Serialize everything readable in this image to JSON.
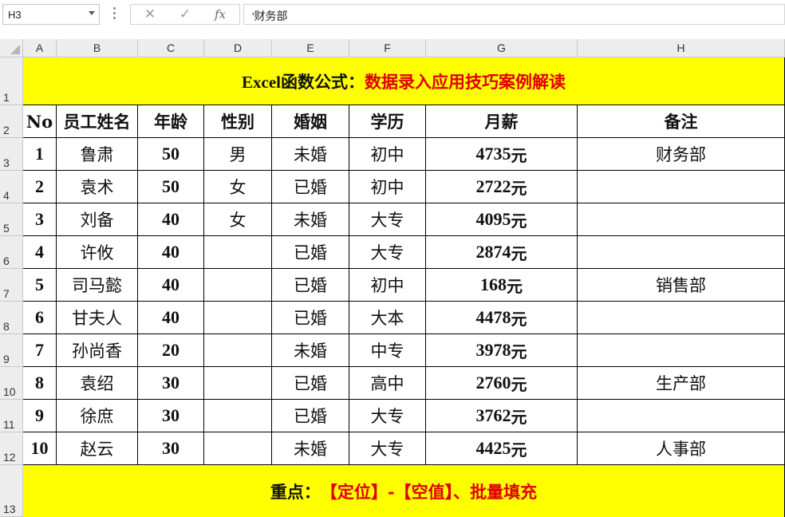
{
  "formula_bar": {
    "name_box": "H3",
    "cancel_icon": "✕",
    "enter_icon": "✓",
    "fx_label": "fx",
    "content": "'财务部"
  },
  "columns": [
    "A",
    "B",
    "C",
    "D",
    "E",
    "F",
    "G",
    "H"
  ],
  "rows": [
    "1",
    "2",
    "3",
    "4",
    "5",
    "6",
    "7",
    "8",
    "9",
    "10",
    "11",
    "12",
    "13"
  ],
  "title": {
    "black": "Excel函数公式：",
    "red": "数据录入应用技巧案例解读"
  },
  "headers": [
    "No",
    "员工姓名",
    "年龄",
    "性别",
    "婚姻",
    "学历",
    "月薪",
    "备注"
  ],
  "table": [
    {
      "no": "1",
      "name": "鲁肃",
      "age": "50",
      "gender": "男",
      "marital": "未婚",
      "edu": "初中",
      "salary": "4735",
      "unit": "元",
      "note": "财务部"
    },
    {
      "no": "2",
      "name": "袁术",
      "age": "50",
      "gender": "女",
      "marital": "已婚",
      "edu": "初中",
      "salary": "2722",
      "unit": "元",
      "note": ""
    },
    {
      "no": "3",
      "name": "刘备",
      "age": "40",
      "gender": "女",
      "marital": "未婚",
      "edu": "大专",
      "salary": "4095",
      "unit": "元",
      "note": ""
    },
    {
      "no": "4",
      "name": "许攸",
      "age": "40",
      "gender": "",
      "marital": "已婚",
      "edu": "大专",
      "salary": "2874",
      "unit": "元",
      "note": ""
    },
    {
      "no": "5",
      "name": "司马懿",
      "age": "40",
      "gender": "",
      "marital": "已婚",
      "edu": "初中",
      "salary": "168",
      "unit": "元",
      "note": "销售部"
    },
    {
      "no": "6",
      "name": "甘夫人",
      "age": "40",
      "gender": "",
      "marital": "已婚",
      "edu": "大本",
      "salary": "4478",
      "unit": "元",
      "note": ""
    },
    {
      "no": "7",
      "name": "孙尚香",
      "age": "20",
      "gender": "",
      "marital": "未婚",
      "edu": "中专",
      "salary": "3978",
      "unit": "元",
      "note": ""
    },
    {
      "no": "8",
      "name": "袁绍",
      "age": "30",
      "gender": "",
      "marital": "已婚",
      "edu": "高中",
      "salary": "2760",
      "unit": "元",
      "note": "生产部"
    },
    {
      "no": "9",
      "name": "徐庶",
      "age": "30",
      "gender": "",
      "marital": "已婚",
      "edu": "大专",
      "salary": "3762",
      "unit": "元",
      "note": ""
    },
    {
      "no": "10",
      "name": "赵云",
      "age": "30",
      "gender": "",
      "marital": "未婚",
      "edu": "大专",
      "salary": "4425",
      "unit": "元",
      "note": "人事部"
    }
  ],
  "footer": {
    "black": "重点：",
    "red": "【定位】-【空值】、批量填充"
  },
  "colors": {
    "banner_bg": "#ffff00",
    "accent_red": "#e00000"
  }
}
